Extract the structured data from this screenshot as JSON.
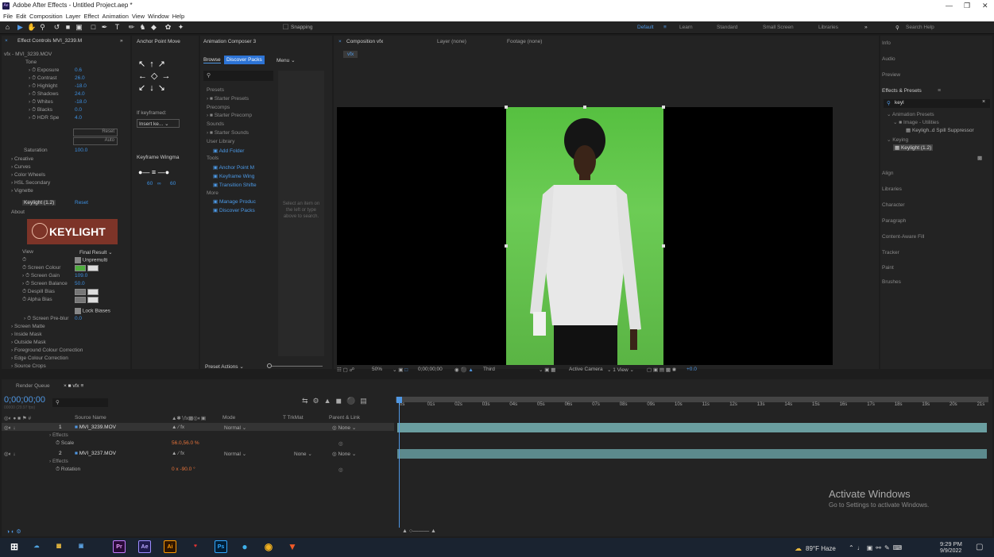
{
  "window": {
    "title": "Adobe After Effects - Untitled Project.aep *",
    "app_icon": "Ae"
  },
  "menu": [
    "File",
    "Edit",
    "Composition",
    "Layer",
    "Effect",
    "Animation",
    "View",
    "Window",
    "Help"
  ],
  "toolbar": {
    "snapping": "Snapping",
    "workspaces": [
      "Default",
      "Learn",
      "Standard",
      "Small Screen",
      "Libraries"
    ],
    "search_placeholder": "Search Help"
  },
  "effect_controls": {
    "tab": "Effect Controls MVI_3239.M",
    "breadcrumb": "vfx - MVI_3239.MOV",
    "section": "Tone",
    "tone": [
      {
        "label": "Exposure",
        "value": "0.6"
      },
      {
        "label": "Contrast",
        "value": "26.0"
      },
      {
        "label": "Highlight",
        "value": "-18.0"
      },
      {
        "label": "Shadows",
        "value": "24.0"
      },
      {
        "label": "Whites",
        "value": "-18.0"
      },
      {
        "label": "Blacks",
        "value": "0.0"
      },
      {
        "label": "HDR Spe",
        "value": "4.0"
      }
    ],
    "reset": "Reset",
    "auto": "Auto",
    "saturation_label": "Saturation",
    "saturation": "100.0",
    "groups": [
      "Creative",
      "Curves",
      "Color Wheels",
      "HSL Secondary",
      "Vignette"
    ],
    "keylight_label": "Keylight (1.2)",
    "keylight_reset": "Reset",
    "about": "About",
    "logo": "KEYLIGHT",
    "view_label": "View",
    "view_value": "Final Result",
    "unpremultiply": "Unpremulti",
    "params": [
      {
        "label": "Screen Colour",
        "value": ""
      },
      {
        "label": "Screen Gain",
        "value": "109.0"
      },
      {
        "label": "Screen Balance",
        "value": "50.0"
      },
      {
        "label": "Despill Bias",
        "value": ""
      },
      {
        "label": "Alpha Bias",
        "value": ""
      }
    ],
    "lock_biases": "Lock Biases",
    "preblur_label": "Screen Pre-blur",
    "preblur": "0.0",
    "tail": [
      "Screen Matte",
      "Inside Mask",
      "Outside Mask",
      "Foreground Colour Correction",
      "Edge Colour Correction",
      "Source Crops"
    ]
  },
  "anchor_panel": {
    "tab": "Anchor Point Move",
    "if_keyframed": "If keyframed:",
    "insert": "Insert ke...",
    "wingman": "Keyframe Wingma",
    "in_val": "60",
    "out_val": "60"
  },
  "composer": {
    "tab": "Animation Composer 3",
    "browse": "Browse",
    "discover": "Discover Packs",
    "menu": "Menu",
    "items": [
      {
        "type": "h",
        "text": "Presets"
      },
      {
        "type": "f",
        "text": "Starter Presets"
      },
      {
        "type": "h",
        "text": "Precomps"
      },
      {
        "type": "f",
        "text": "Starter Precomp"
      },
      {
        "type": "h",
        "text": "Sounds"
      },
      {
        "type": "f",
        "text": "Starter Sounds"
      },
      {
        "type": "h",
        "text": "User Library"
      },
      {
        "type": "b",
        "text": "Add Folder"
      },
      {
        "type": "h",
        "text": "Tools"
      },
      {
        "type": "b",
        "text": "Anchor Point M"
      },
      {
        "type": "b",
        "text": "Keyframe Wing"
      },
      {
        "type": "b",
        "text": "Transition Shifte"
      },
      {
        "type": "h",
        "text": "More"
      },
      {
        "type": "b",
        "text": "Manage Produc"
      },
      {
        "type": "b",
        "text": "Discover Packs"
      }
    ],
    "select_hint": "Select an item on the left or type above to search.",
    "preset_actions": "Preset Actions"
  },
  "composition": {
    "tab": "Composition vfx",
    "layer_tab": "Layer (none)",
    "footage_tab": "Footage (none)",
    "comp_name": "vfx",
    "zoom": "50%",
    "timecode": "0;00;00;00",
    "resolution": "Third",
    "camera": "Active Camera",
    "views": "1 View",
    "exposure": "+0.0"
  },
  "right_panels": [
    "Info",
    "Audio",
    "Preview",
    "Effects & Presets",
    "Align",
    "Libraries",
    "Character",
    "Paragraph",
    "Content-Aware Fill",
    "Tracker",
    "Paint",
    "Brushes"
  ],
  "effects_presets": {
    "search": "keyl",
    "tree": [
      "Animation Presets",
      "Image - Utilities",
      "Keyligh..d Spill Suppressor",
      "Keying",
      "Keylight (1.2)"
    ]
  },
  "timeline": {
    "tabs": [
      "Render Queue",
      "vfx"
    ],
    "timecode": "0;00;00;00",
    "fps": "00000 (29.97 fps)",
    "cols": [
      "Source Name",
      "Mode",
      "T TrkMat",
      "Parent & Link"
    ],
    "layers": [
      {
        "num": "1",
        "name": "MVI_3239.MOV",
        "mode": "Normal",
        "trkmat": "",
        "parent": "None",
        "sub": "Effects",
        "prop": "Scale",
        "prop_val": "56.0,56.0 %"
      },
      {
        "num": "2",
        "name": "MVI_3237.MOV",
        "mode": "Normal",
        "trkmat": "None",
        "parent": "None",
        "sub": "Effects",
        "prop": "Rotation",
        "prop_val": "0 x -90.0 °"
      }
    ],
    "ruler": [
      "0s",
      "01s",
      "02s",
      "03s",
      "04s",
      "05s",
      "06s",
      "07s",
      "08s",
      "09s",
      "10s",
      "11s",
      "12s",
      "13s",
      "14s",
      "15s",
      "16s",
      "17s",
      "18s",
      "19s",
      "20s",
      "21s"
    ]
  },
  "activate": {
    "title": "Activate Windows",
    "sub": "Go to Settings to activate Windows."
  },
  "taskbar": {
    "weather": "89°F Haze",
    "time": "9:29 PM",
    "date": "9/9/2022",
    "apps": [
      "Pr",
      "Ae",
      "Ai",
      "Ps"
    ]
  }
}
